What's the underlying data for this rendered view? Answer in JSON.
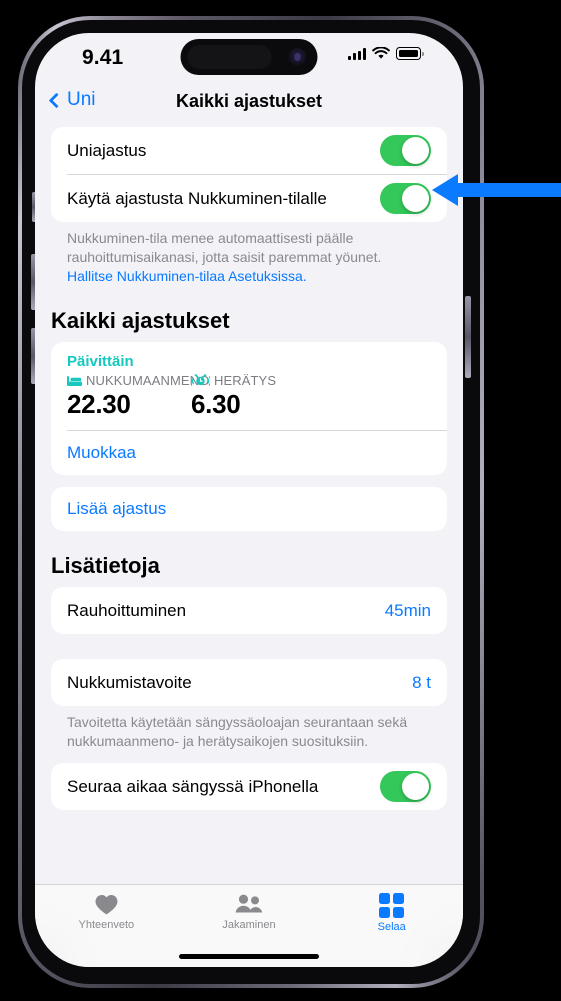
{
  "status_bar": {
    "time": "9.41",
    "cellular_icon": "signal-bars-icon",
    "wifi_icon": "wifi-icon",
    "battery_icon": "battery-icon"
  },
  "nav": {
    "back_label": "Uni",
    "back_icon": "chevron-left-icon",
    "title": "Kaikki ajastukset"
  },
  "schedule_toggles": {
    "rows": [
      {
        "label": "Uniajastus",
        "toggle": "on"
      },
      {
        "label": "Käytä ajastusta Nukkuminen-tilalle",
        "toggle": "on"
      }
    ],
    "footnote_text": "Nukkuminen-tila menee automaattisesti päälle rauhoittumisaikanasi, jotta saisit paremmat yöunet. ",
    "footnote_link": "Hallitse Nukkuminen-tilaa Asetuksissa."
  },
  "all_schedules": {
    "header": "Kaikki ajastukset",
    "card": {
      "day_label": "Päivittäin",
      "bedtime_icon": "bed-icon",
      "bedtime_caption": "NUKKUMAANMENO",
      "bedtime_value": "22.30",
      "alarm_icon": "alarm-clock-icon",
      "alarm_caption": "HERÄTYS",
      "alarm_value": "6.30",
      "edit_label": "Muokkaa"
    },
    "add_label": "Lisää ajastus"
  },
  "more_info": {
    "header": "Lisätietoja",
    "winddown": {
      "label": "Rauhoittuminen",
      "value": "45min"
    },
    "sleep_goal": {
      "label": "Nukkumistavoite",
      "value": "8 t"
    },
    "sleep_goal_footnote": "Tavoitetta käytetään sängyssäoloajan seurantaan sekä nukkumaanmeno- ja herätysaikojen suosituksiin.",
    "track_time": {
      "label": "Seuraa aikaa sängyssä iPhonella",
      "toggle": "on"
    }
  },
  "tab_bar": {
    "tabs": [
      {
        "label": "Yhteenveto",
        "icon": "heart-icon",
        "active": false
      },
      {
        "label": "Jakaminen",
        "icon": "people-icon",
        "active": false
      },
      {
        "label": "Selaa",
        "icon": "grid-icon",
        "active": true
      }
    ]
  },
  "annotation": {
    "arrow_icon": "left-arrow-annotation",
    "color": "#0a7aff",
    "points_to": "Uniajastus"
  },
  "colors": {
    "accent_blue": "#0a7aff",
    "toggle_green": "#34c759",
    "sleep_teal": "#16c8be",
    "background": "#f2f2f7",
    "card": "#ffffff"
  }
}
